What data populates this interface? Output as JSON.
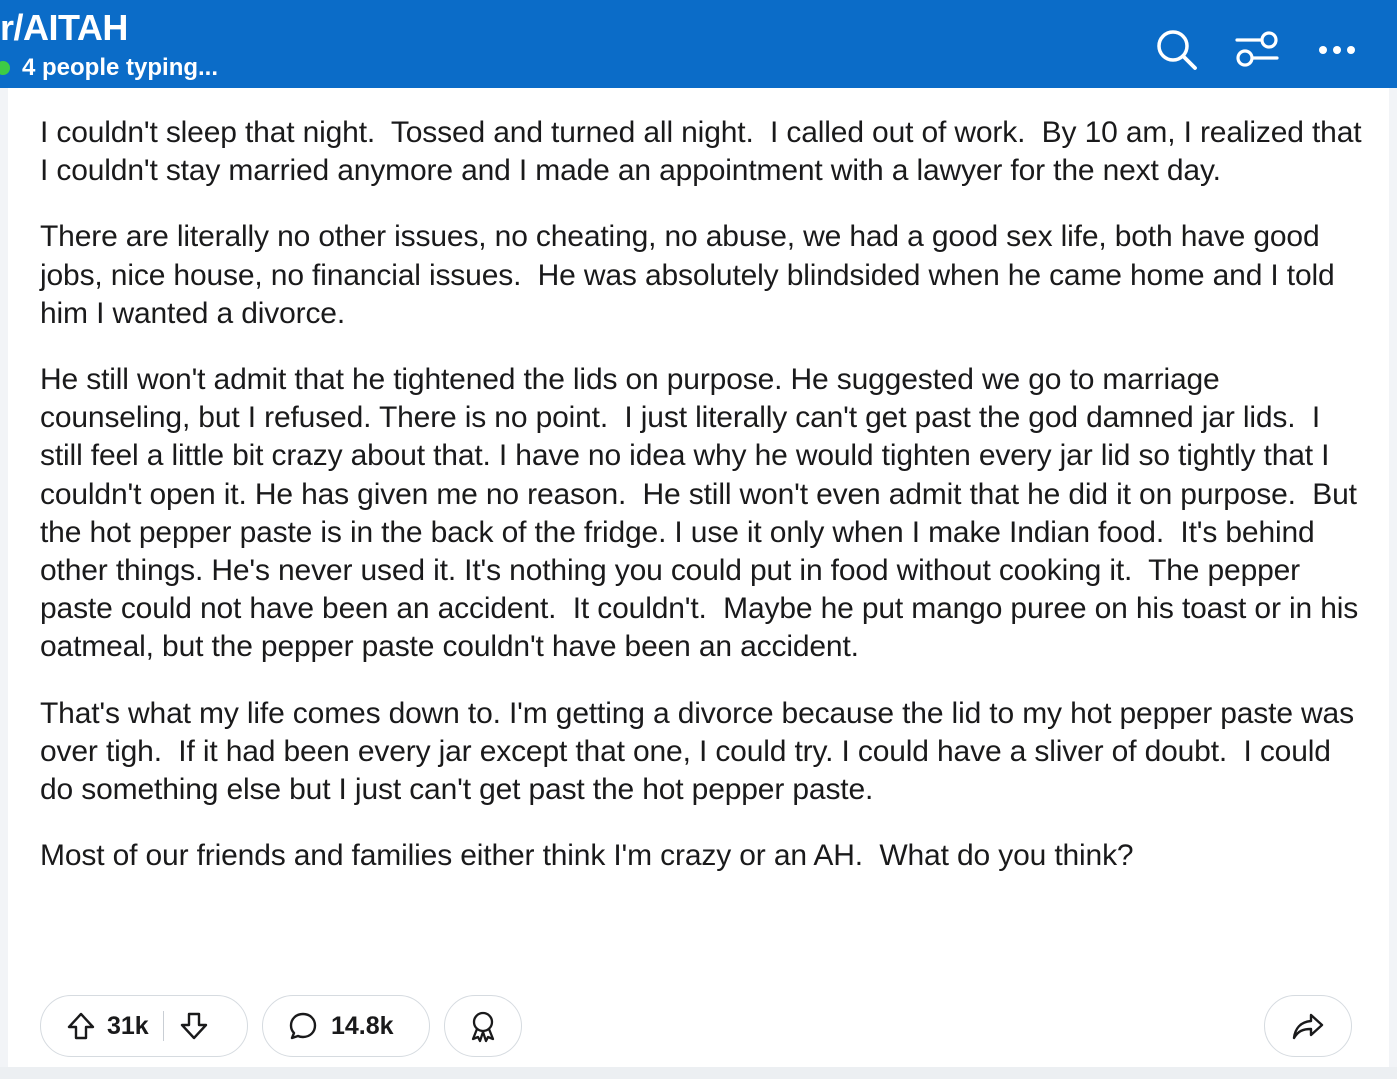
{
  "header": {
    "subreddit": "r/AITAH",
    "typing_status": "4 people typing...",
    "icons": [
      "search-icon",
      "filter-sliders-icon",
      "more-options-icon"
    ],
    "bar_color": "#0b6cc8",
    "typing_dot_color": "#3dcc45"
  },
  "post": {
    "paragraphs": [
      "I couldn't sleep that night.  Tossed and turned all night.  I called out of work.  By 10 am, I realized that I couldn't stay married anymore and I made an appointment with a lawyer for the next day.",
      "There are literally no other issues, no cheating, no abuse, we had a good sex life, both have good jobs, nice house, no financial issues.  He was absolutely blindsided when he came home and I told him I wanted a divorce.",
      "He still won't admit that he tightened the lids on purpose. He suggested we go to marriage counseling, but I refused. There is no point.  I just literally can't get past the god damned jar lids.  I still feel a little bit crazy about that. I have no idea why he would tighten every jar lid so tightly that I couldn't open it. He has given me no reason.  He still won't even admit that he did it on purpose.  But the hot pepper paste is in the back of the fridge. I use it only when I make Indian food.  It's behind other things. He's never used it. It's nothing you could put in food without cooking it.  The pepper paste could not have been an accident.  It couldn't.  Maybe he put mango puree on his toast or in his oatmeal, but the pepper paste couldn't have been an accident.",
      "That's what my life comes down to. I'm getting a divorce because the lid to my hot pepper paste was over tigh.  If it had been every jar except that one, I could try. I could have a sliver of doubt.  I could do something else but I just can't get past the hot pepper paste.",
      "Most of our friends and families either think I'm crazy or an AH.  What do you think?"
    ]
  },
  "actions": {
    "upvote_count": "31k",
    "comment_count": "14.8k",
    "icons": [
      "upvote-icon",
      "downvote-icon",
      "comment-icon",
      "award-icon",
      "share-icon"
    ]
  }
}
